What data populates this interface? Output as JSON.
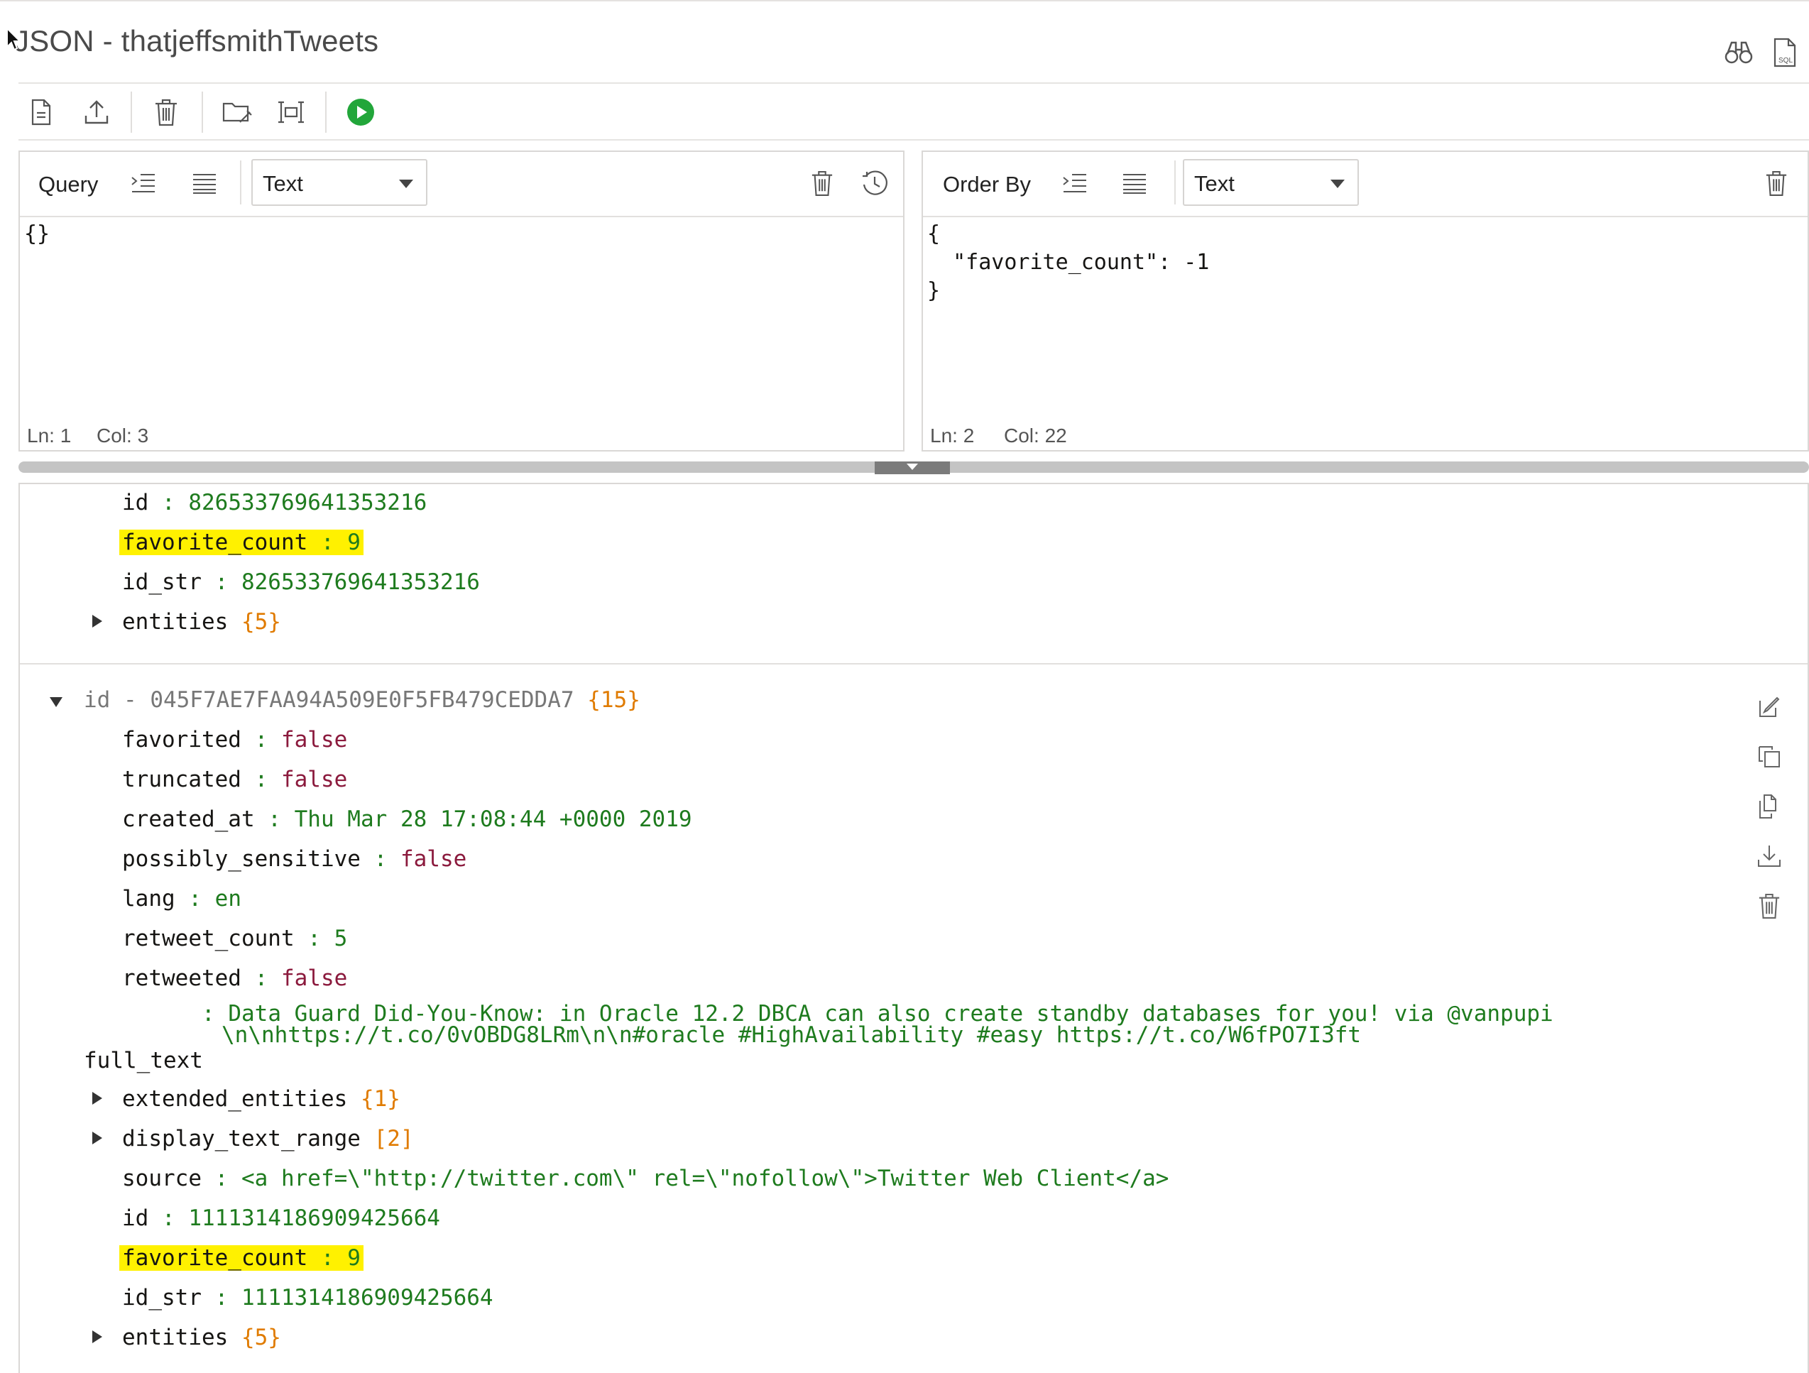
{
  "page": {
    "title": "JSON - thatjeffsmithTweets"
  },
  "header_icons": [
    "binoculars-icon",
    "sql-file-icon"
  ],
  "toolbar": {
    "buttons": [
      "new-document-icon",
      "upload-icon",
      "delete-icon",
      "open-folder-icon",
      "bulk-edit-icon",
      "run-icon"
    ]
  },
  "query_panel": {
    "label": "Query",
    "mode": "Text",
    "content": "{}",
    "status_ln": "Ln: 1",
    "status_col": "Col: 3"
  },
  "order_panel": {
    "label": "Order By",
    "mode": "Text",
    "content": "{\n  \"favorite_count\": -1\n}",
    "status_ln": "Ln: 2",
    "status_col": "Col: 22"
  },
  "doc1": {
    "id_key": "id",
    "id_val": "826533769641353216",
    "fav_key": "favorite_count",
    "fav_val": "9",
    "idstr_key": "id_str",
    "idstr_val": "826533769641353216",
    "entities_key": "entities",
    "entities_count": "{5}"
  },
  "doc2": {
    "header_label": "id - 045F7AE7FAA94A509E0F5FB479CEDDA7",
    "header_count": "{15}",
    "favorited_key": "favorited",
    "favorited_val": "false",
    "truncated_key": "truncated",
    "truncated_val": "false",
    "created_key": "created_at",
    "created_val": "Thu Mar 28 17:08:44 +0000 2019",
    "sensitive_key": "possibly_sensitive",
    "sensitive_val": "false",
    "lang_key": "lang",
    "lang_val": "en",
    "retweet_count_key": "retweet_count",
    "retweet_count_val": "5",
    "retweeted_key": "retweeted",
    "retweeted_val": "false",
    "full_text_key": "full_text",
    "full_text_line1": "Data Guard Did-You-Know: in Oracle 12.2 DBCA can also create standby databases for you! via @vanpupi",
    "full_text_line2": "\\n\\nhttps://t.co/0vOBDG8LRm\\n\\n#oracle #HighAvailability #easy https://t.co/W6fPO7I3ft",
    "ext_entities_key": "extended_entities",
    "ext_entities_count": "{1}",
    "display_range_key": "display_text_range",
    "display_range_count": "[2]",
    "source_key": "source",
    "source_val": "<a href=\\\"http://twitter.com\\\" rel=\\\"nofollow\\\">Twitter Web Client</a>",
    "id_key": "id",
    "id_val": "1111314186909425664",
    "fav_key": "favorite_count",
    "fav_val": "9",
    "idstr_key": "id_str",
    "idstr_val": "1111314186909425664",
    "entities_key": "entities",
    "entities_count": "{5}"
  },
  "doc_actions": [
    "edit-icon",
    "copy-icon",
    "duplicate-icon",
    "download-icon",
    "delete-icon"
  ]
}
